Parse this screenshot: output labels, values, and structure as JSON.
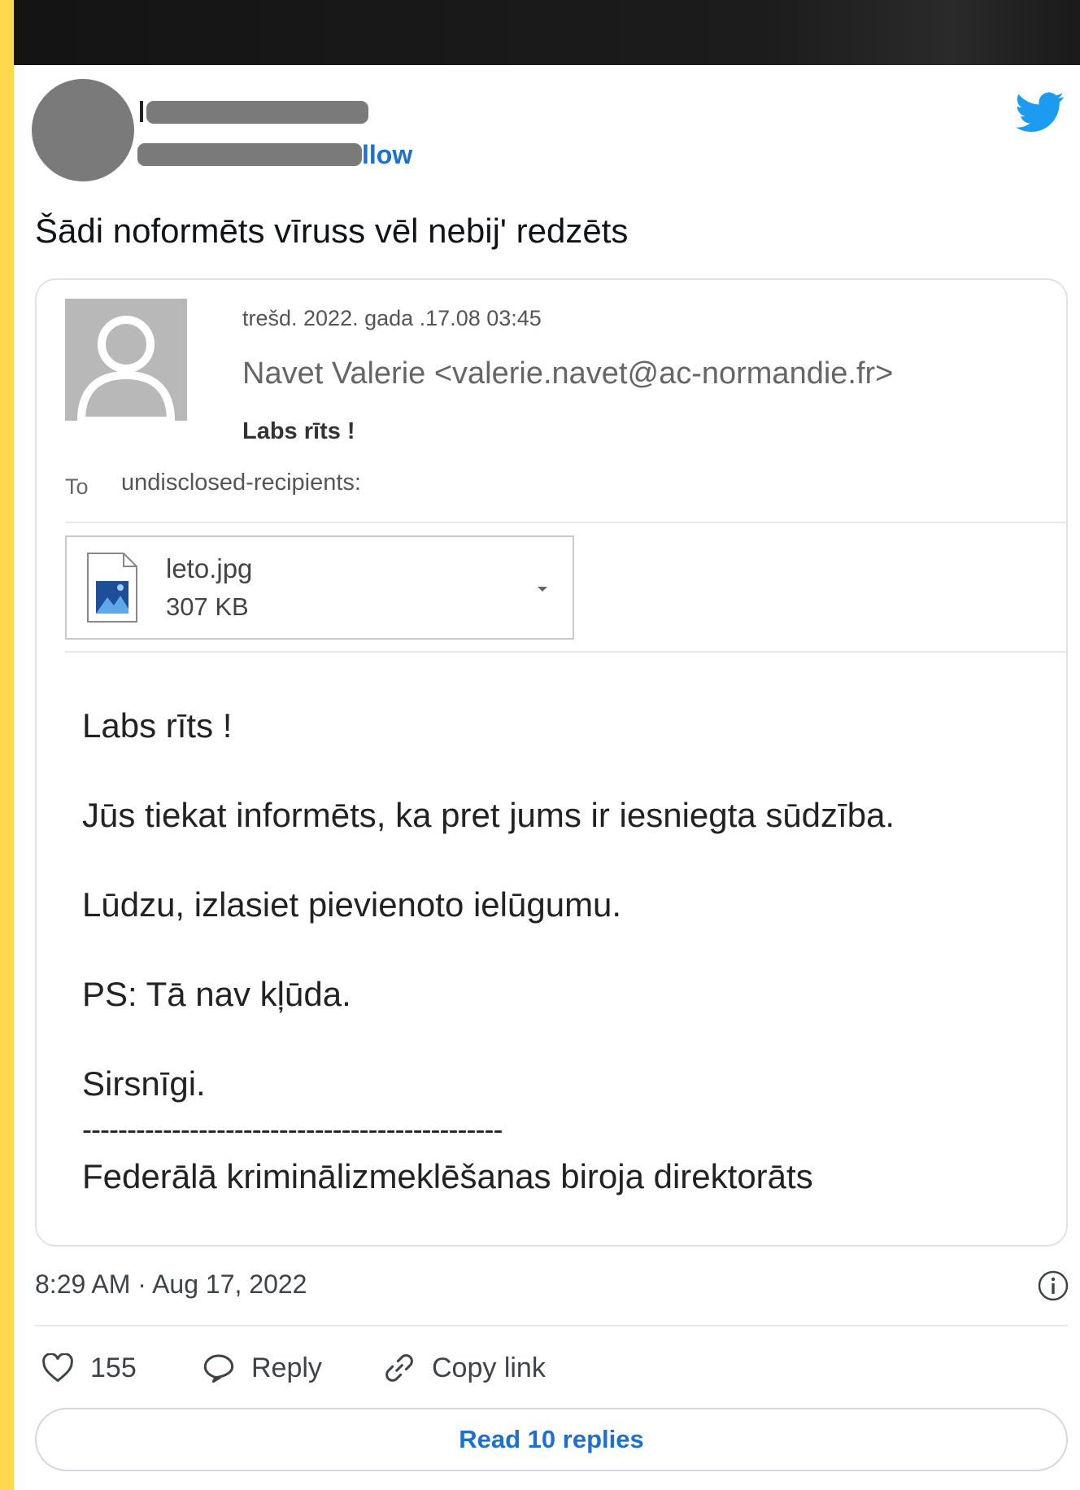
{
  "tweet": {
    "follow_label": "llow",
    "text": "Šādi noformēts vīruss vēl nebij' redzēts",
    "timestamp": "8:29 AM · Aug 17, 2022",
    "likes": "155",
    "reply_label": "Reply",
    "copy_link_label": "Copy link",
    "read_replies_label": "Read 10 replies",
    "accent_color": "#1d9bf0"
  },
  "email": {
    "date": "trešd. 2022.  gada .17.08 03:45",
    "sender": "Navet Valerie <valerie.navet@ac-normandie.fr>",
    "subject": "Labs rīts !",
    "to_label": "To",
    "recipients": "undisclosed-recipients:",
    "attachment": {
      "name": "leto.jpg",
      "size": "307 KB"
    },
    "body": [
      "Labs rīts !",
      "Jūs tiekat informēts, ka pret jums ir iesniegta sūdzība.",
      "Lūdzu, izlasiet pievienoto ielūgumu.",
      "PS: Tā nav kļūda.",
      "Sirsnīgi.",
      "-----------------------------------------------",
      "Federālā kriminālizmeklēšanas biroja direktorāts"
    ]
  }
}
